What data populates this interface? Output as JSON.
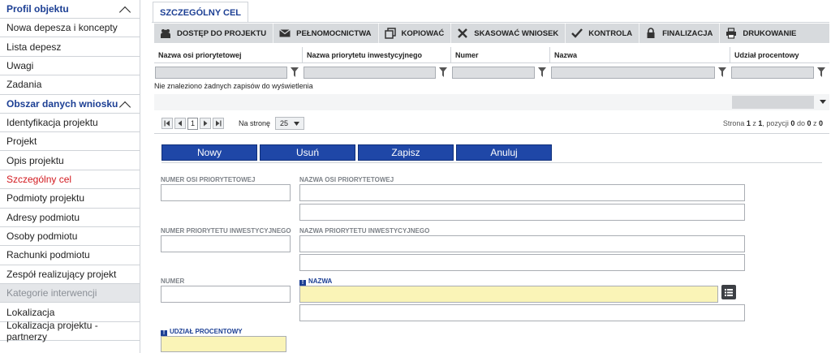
{
  "sidebar": {
    "section1": {
      "title": "Profil objektu"
    },
    "items1": [
      {
        "label": "Nowa depesza i koncepty"
      },
      {
        "label": "Lista depesz"
      },
      {
        "label": "Uwagi"
      },
      {
        "label": "Zadania"
      }
    ],
    "section2": {
      "title": "Obszar danych wniosku"
    },
    "items2": [
      {
        "label": "Identyfikacja projektu"
      },
      {
        "label": "Projekt"
      },
      {
        "label": "Opis projektu"
      },
      {
        "label": "Szczególny cel"
      },
      {
        "label": "Podmioty projektu"
      },
      {
        "label": "Adresy podmiotu"
      },
      {
        "label": "Osoby podmiotu"
      },
      {
        "label": "Rachunki podmiotu"
      },
      {
        "label": "Zespół realizujący projekt"
      },
      {
        "label": "Kategorie interwencji"
      },
      {
        "label": "Lokalizacja"
      },
      {
        "label": "Lokalizacja projektu - partnerzy"
      }
    ]
  },
  "tab": {
    "label": "SZCZEGÓLNY CEL"
  },
  "toolbar": {
    "access": "DOSTĘP DO PROJEKTU",
    "proxy": "PEŁNOMOCNICTWA",
    "copy": "KOPIOWAĆ",
    "delete": "SKASOWAĆ WNIOSEK",
    "check": "KONTROLA",
    "finalize": "FINALIZACJA",
    "print": "DRUKOWANIE"
  },
  "grid": {
    "columns": [
      "Nazwa osi priorytetowej",
      "Nazwa priorytetu inwestycyjnego",
      "Numer",
      "Nazwa",
      "Udział procentowy"
    ],
    "empty": "Nie znaleziono żadnych zapisów do wyświetlenia"
  },
  "pager": {
    "page": "1",
    "per_page_label": "Na stronę",
    "per_page": "25",
    "info_prefix": "Strona ",
    "page_cur": "1",
    "info_z": " z ",
    "page_total": "1",
    "info_pos": ", pozycji ",
    "pos_from": "0",
    "info_do": " do ",
    "pos_to": "0",
    "pos_z": "0"
  },
  "actions": {
    "new": "Nowy",
    "delete": "Usuń",
    "save": "Zapisz",
    "cancel": "Anuluj"
  },
  "form": {
    "numer_osi": "NUMER OSI PRIORYTETOWEJ",
    "nazwa_osi": "NAZWA OSI PRIORYTETOWEJ",
    "numer_priorytetu": "NUMER PRIORYTETU INWESTYCYJNEGO",
    "nazwa_priorytetu": "NAZWA PRIORYTETU INWESTYCYJNEGO",
    "numer": "NUMER",
    "nazwa": "NAZWA",
    "udzial": "UDZIAŁ PROCENTOWY"
  },
  "colors": {
    "accent": "#1c3f94",
    "button": "#1f47a7",
    "required_field": "#faf4b7",
    "active_nav": "#d2191f"
  }
}
